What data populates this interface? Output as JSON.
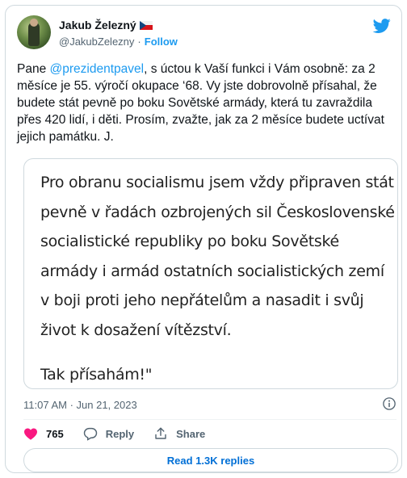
{
  "tweet": {
    "author": {
      "display_name": "Jakub Železný",
      "handle": "@JakubZelezny",
      "follow_label": "Follow",
      "flag_icon": "czech-flag-icon",
      "verified_badge": false
    },
    "platform_icon": "twitter-bird-icon",
    "text": {
      "prefix": "Pane ",
      "mention": "@prezidentpavel",
      "body": ", s úctou k Vaší funkci i Vám osobně: za 2 měsíce je 55. výročí okupace ‘68. Vy jste dobrovolně přísahal, že budete stát pevně po boku Sovětské armády, která tu zavraždila přes 420 lidí, i děti. Prosím, zvažte, jak za 2 měsíce budete uctívat jejich památku. J."
    },
    "image_text": {
      "lines": [
        "Pro obranu socialismu jsem vždy připraven stát",
        "pevně v řadách ozbrojených sil Československé",
        "socialistické republiky po boku Sovětské",
        "armády i armád ostatních socialistických zemí",
        "v boji proti jeho nepřátelům a nasadit i svůj",
        "život k dosažení vítězství."
      ],
      "closing": "Tak přísahám!\""
    },
    "timestamp": "11:07 AM · Jun 21, 2023",
    "actions": {
      "like_count": "765",
      "reply_label": "Reply",
      "share_label": "Share"
    },
    "read_replies_label": "Read 1.3K replies",
    "colors": {
      "accent": "#1d9bf0",
      "like": "#f91880",
      "text": "#0f1419",
      "secondary": "#536471",
      "border": "#cfd9de"
    }
  }
}
